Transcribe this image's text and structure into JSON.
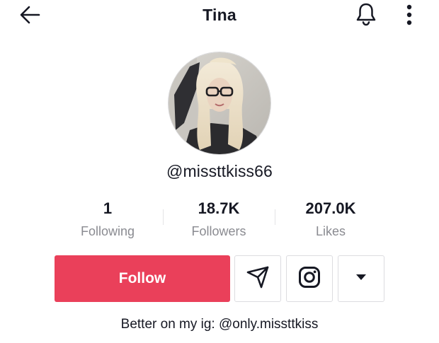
{
  "header": {
    "title": "Tina",
    "back_icon": "arrow-left-icon",
    "notification_icon": "bell-icon",
    "more_icon": "more-vertical-icon"
  },
  "profile": {
    "username": "@missttkiss66",
    "bio": "Better on my ig: @only.missttkiss"
  },
  "stats": [
    {
      "value": "1",
      "label": "Following"
    },
    {
      "value": "18.7K",
      "label": "Followers"
    },
    {
      "value": "207.0K",
      "label": "Likes"
    }
  ],
  "actions": {
    "follow_label": "Follow",
    "message_icon": "send-icon",
    "instagram_icon": "instagram-icon",
    "dropdown_icon": "caret-down-icon"
  },
  "colors": {
    "follow_button": "#ea405a",
    "text_primary": "#161823",
    "text_secondary": "#8a8b91",
    "border": "#dcdce0"
  }
}
